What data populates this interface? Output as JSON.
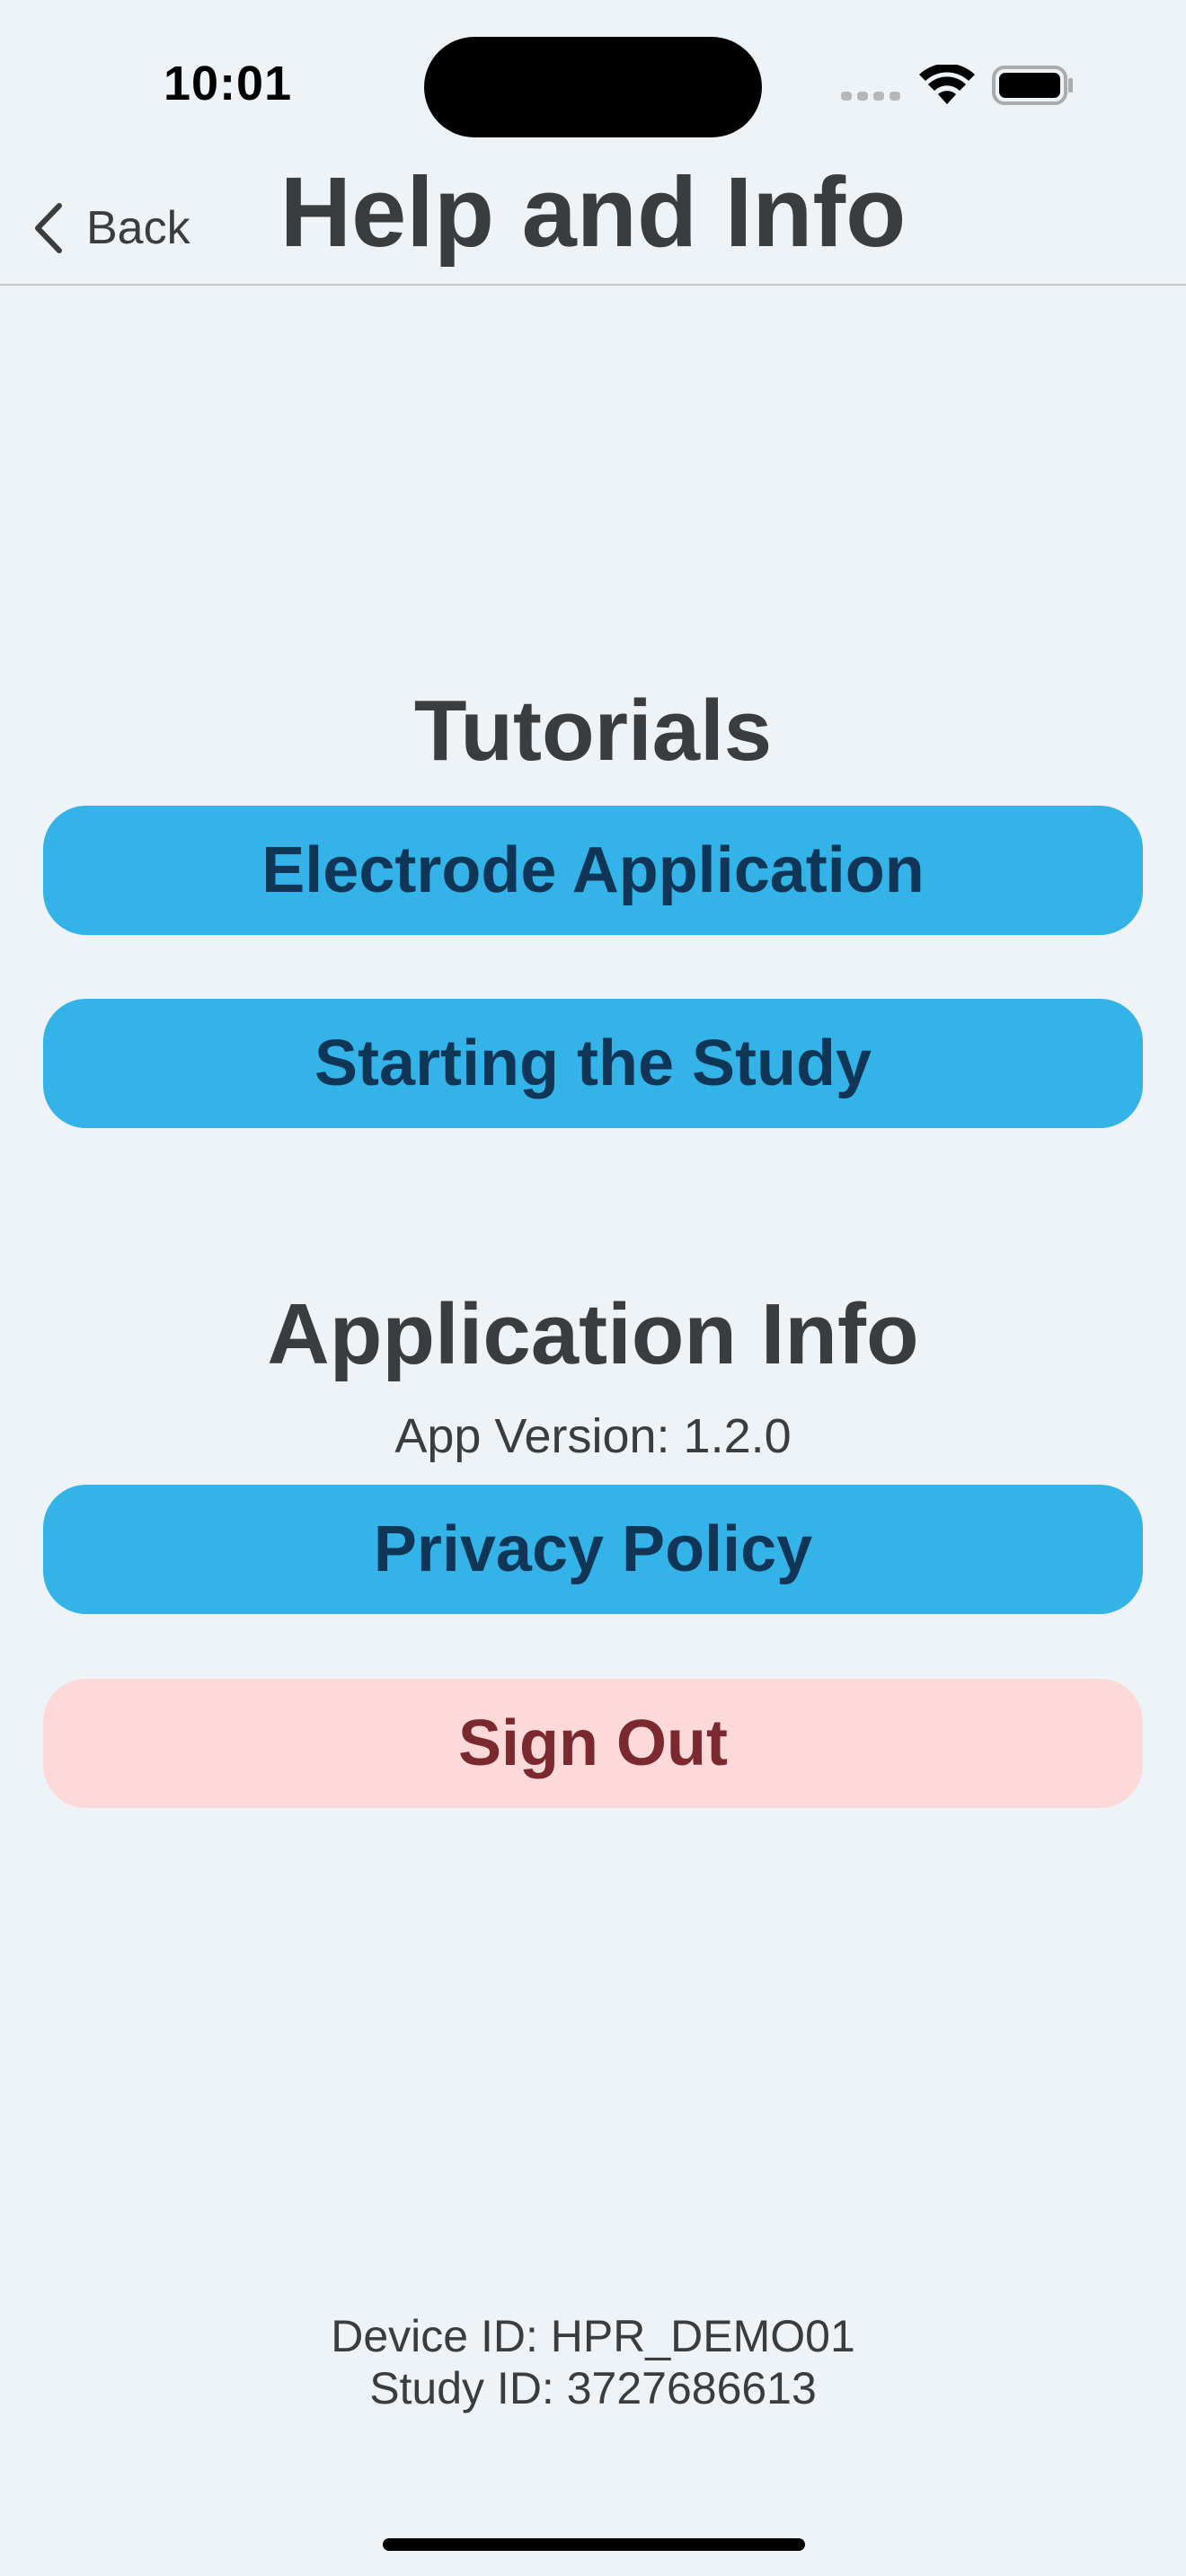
{
  "status_bar": {
    "time": "10:01"
  },
  "nav": {
    "back_label": "Back",
    "title": "Help and Info"
  },
  "tutorials": {
    "heading": "Tutorials",
    "buttons": [
      {
        "label": "Electrode Application"
      },
      {
        "label": "Starting the Study"
      }
    ]
  },
  "app_info": {
    "heading": "Application Info",
    "version": "App Version: 1.2.0",
    "privacy_label": "Privacy Policy",
    "sign_out_label": "Sign Out"
  },
  "footer": {
    "device_id": "Device ID: HPR_DEMO01",
    "study_id": "Study ID: 3727686613"
  },
  "colors": {
    "background": "#edf3f7",
    "primary_button": "#33b3e8",
    "primary_button_text": "#0f3557",
    "danger_button": "#fed9d9",
    "danger_button_text": "#7a2a2e"
  }
}
